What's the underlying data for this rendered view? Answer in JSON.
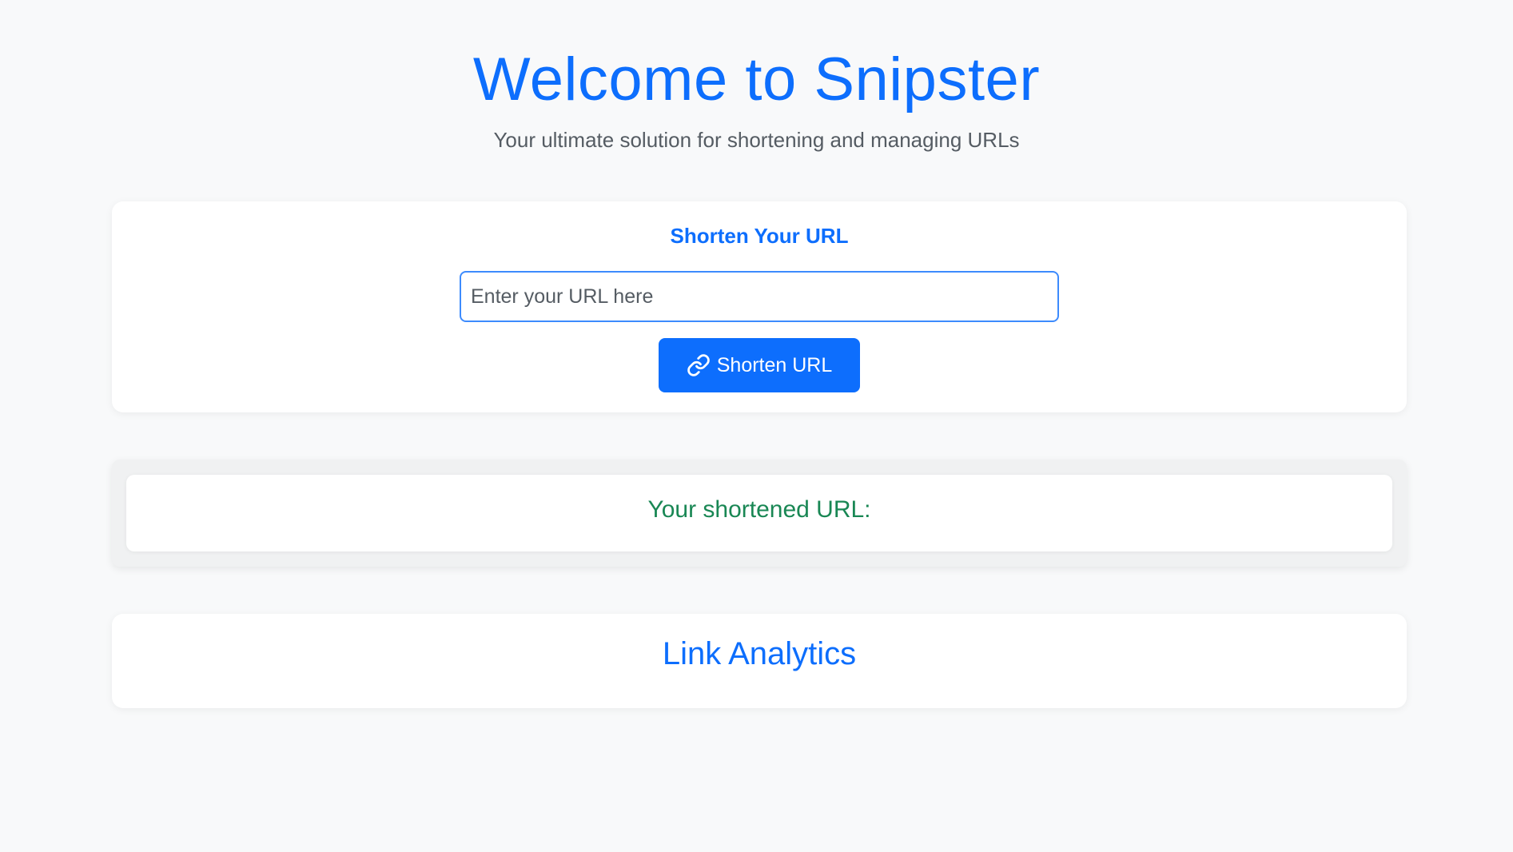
{
  "header": {
    "title": "Welcome to Snipster",
    "subtitle": "Your ultimate solution for shortening and managing URLs"
  },
  "shorten": {
    "heading": "Shorten Your URL",
    "input_value": "",
    "input_placeholder": "Enter your URL here",
    "button_label": "Shorten URL",
    "button_icon": "link-icon"
  },
  "result": {
    "heading": "Your shortened URL:"
  },
  "analytics": {
    "heading": "Link Analytics"
  },
  "colors": {
    "primary": "#0d6efd",
    "success": "#198754",
    "background": "#f8f9fa",
    "muted_text": "#555c63"
  }
}
